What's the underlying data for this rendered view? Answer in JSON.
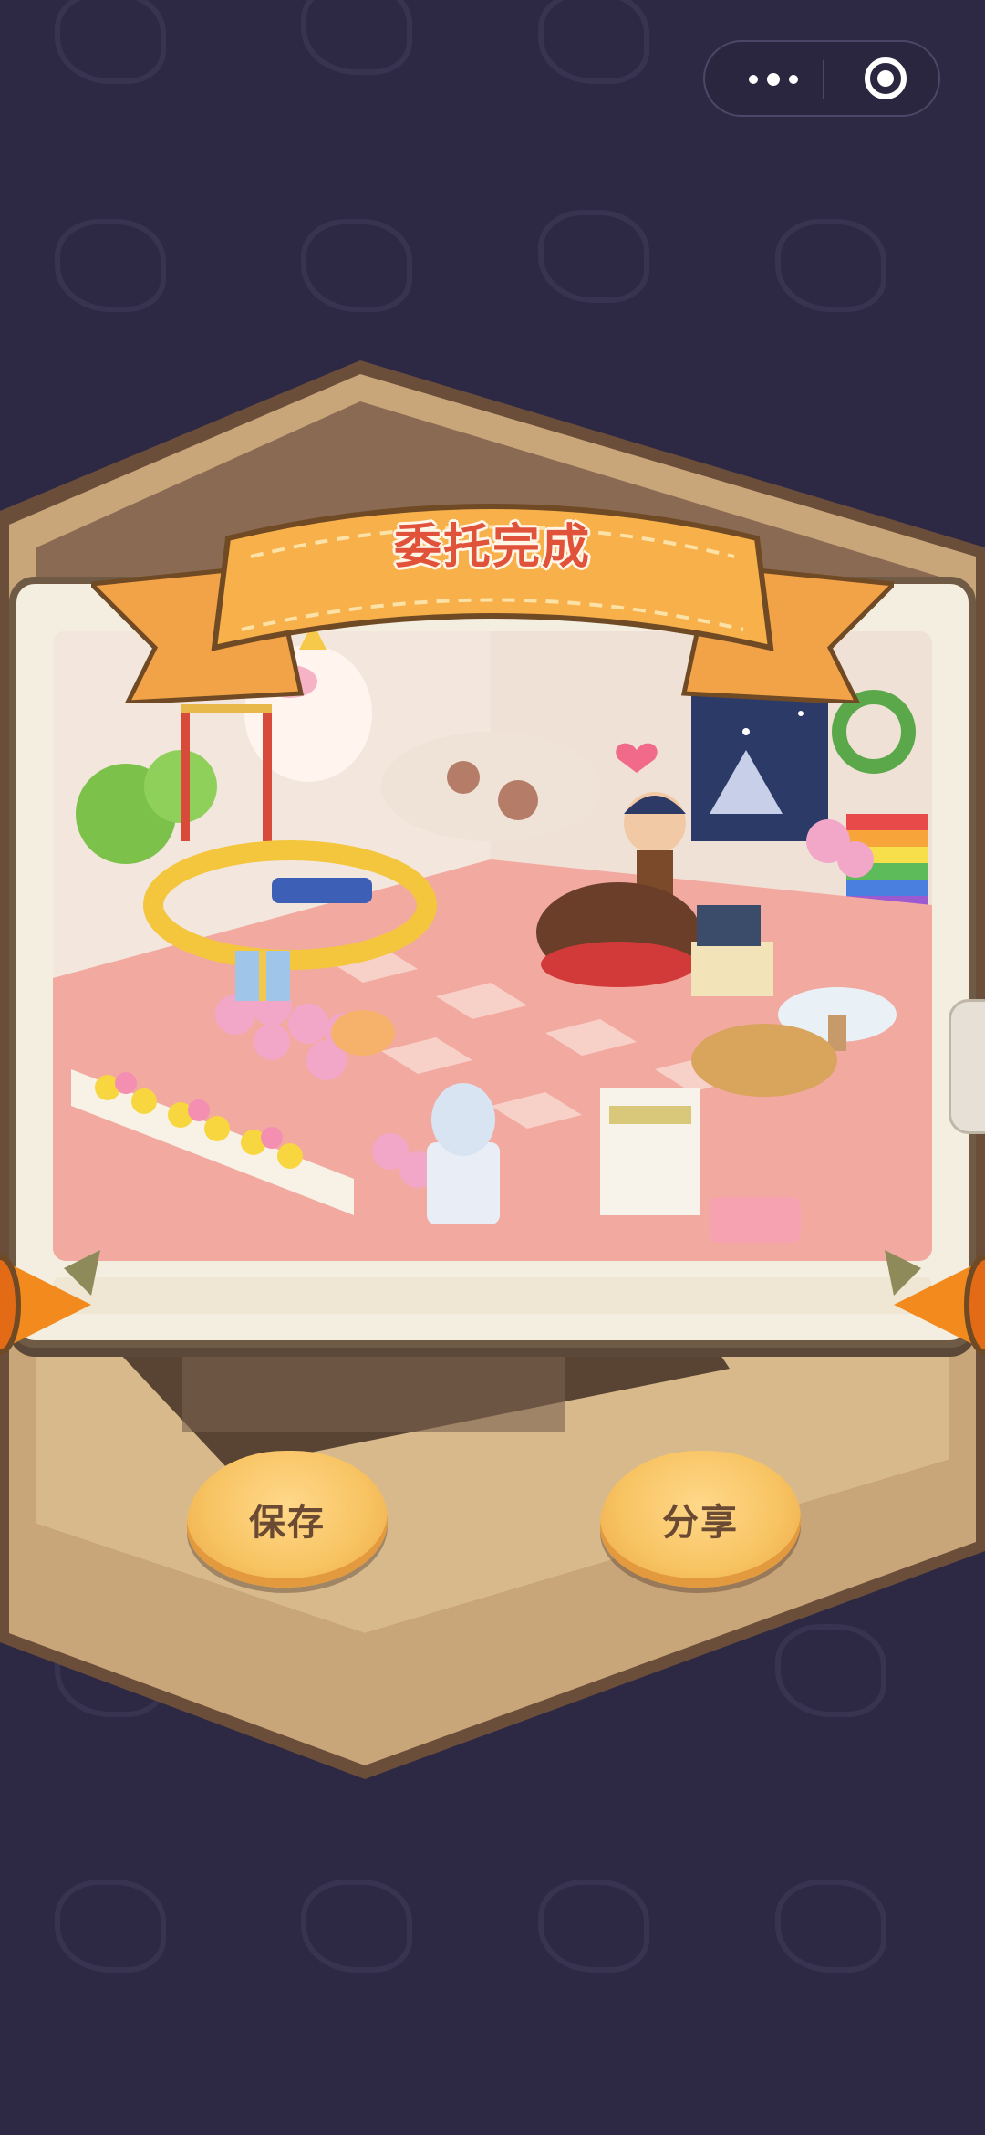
{
  "capsule": {
    "more_icon": "more-dots-icon",
    "close_icon": "target-circle-icon"
  },
  "dialog": {
    "title": "委托完成"
  },
  "actions": {
    "save_label": "保存",
    "share_label": "分享"
  },
  "colors": {
    "background": "#2d2944",
    "ribbon": "#f7a94e",
    "title_text": "#e0523a",
    "button": "#f8c463",
    "button_text": "#6a4a32",
    "frame": "#f4eee0"
  }
}
